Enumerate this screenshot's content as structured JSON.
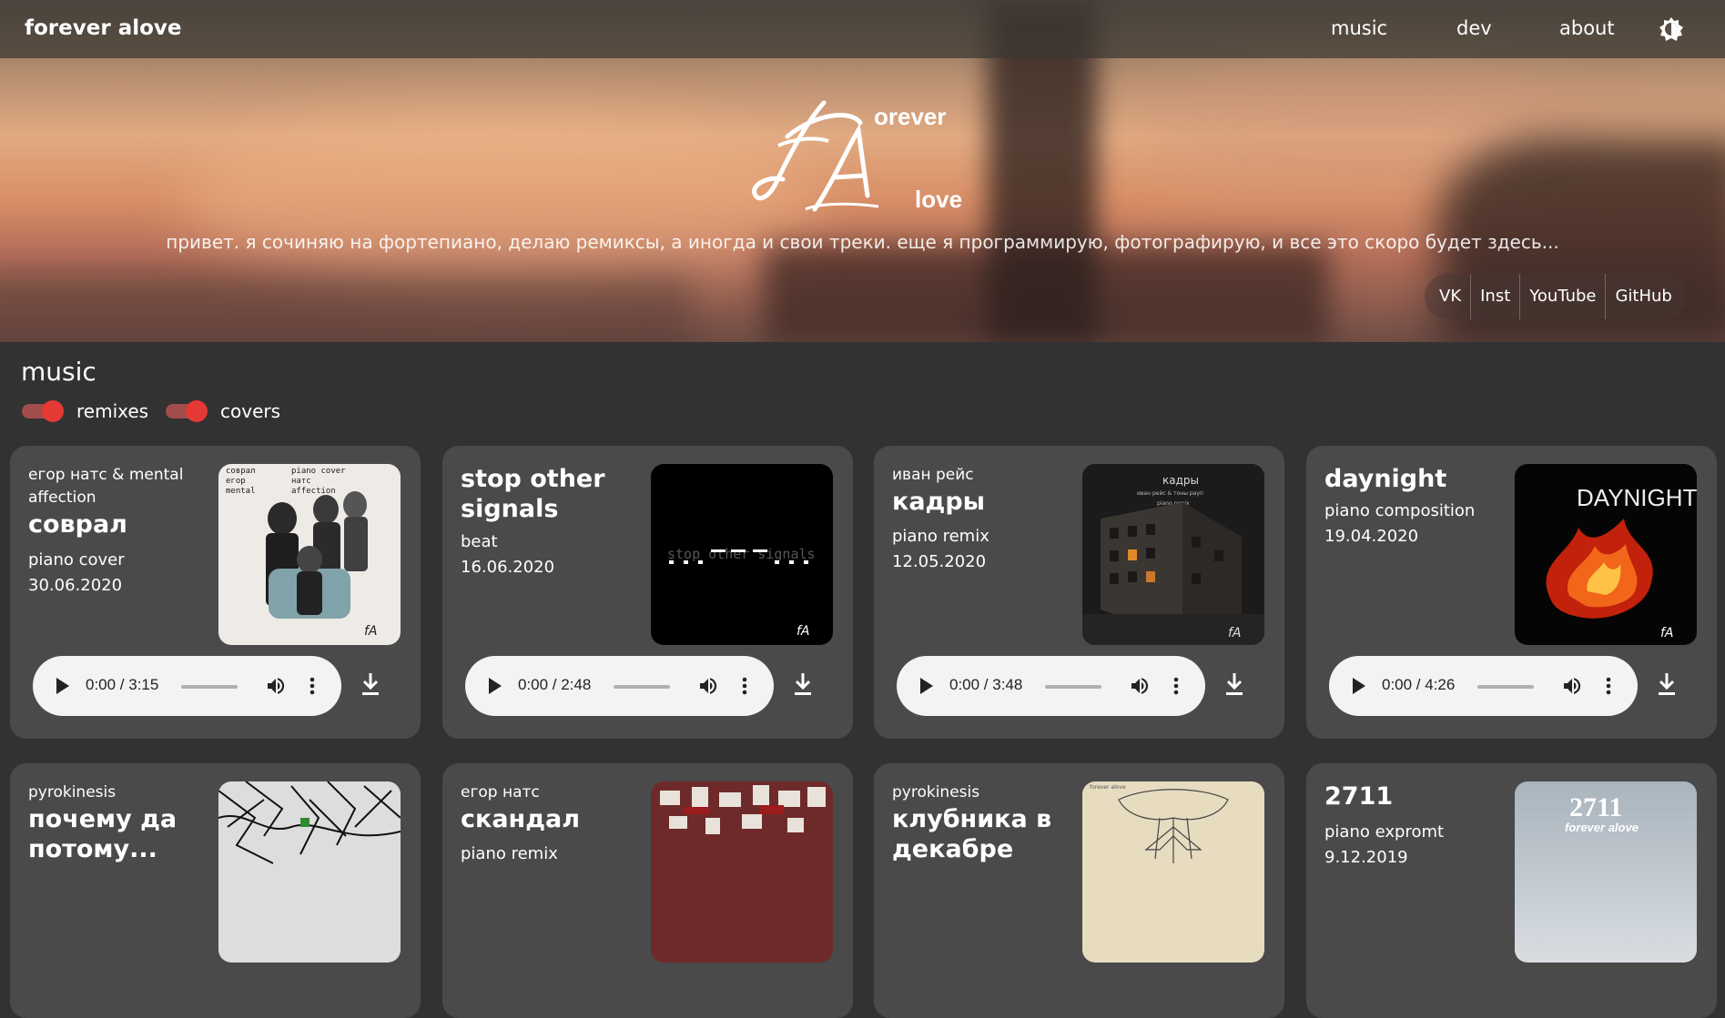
{
  "nav": {
    "brand": "forever alove",
    "links": [
      "music",
      "dev",
      "about"
    ],
    "theme_icon": "theme-toggle-icon"
  },
  "hero": {
    "logo_text_top": "orever",
    "logo_text_bottom": "love",
    "tagline": "привет. я сочиняю на фортепиано, делаю ремиксы, а иногда и свои треки. еще я программирую, фотографирую, и все это скоро будет здесь...",
    "social": [
      "VK",
      "Inst",
      "YouTube",
      "GitHub"
    ]
  },
  "music": {
    "title": "music",
    "filters": [
      {
        "label": "remixes",
        "on": true
      },
      {
        "label": "covers",
        "on": true
      }
    ],
    "tracks": [
      {
        "artist": "егор натс & mental affection",
        "title": "соврал",
        "kind": "piano cover",
        "date": "30.06.2020",
        "time": "0:00 / 3:15"
      },
      {
        "artist": "",
        "title": "stop other signals",
        "kind": "beat",
        "date": "16.06.2020",
        "time": "0:00 / 2:48"
      },
      {
        "artist": "иван рейс",
        "title": "кадры",
        "kind": "piano remix",
        "date": "12.05.2020",
        "time": "0:00 / 3:48"
      },
      {
        "artist": "",
        "title": "daynight",
        "kind": "piano composition",
        "date": "19.04.2020",
        "time": "0:00 / 4:26"
      },
      {
        "artist": "pyrokinesis",
        "title": "почему да потому...",
        "kind": "",
        "date": ""
      },
      {
        "artist": "егор натс",
        "title": "скандал",
        "kind": "piano remix",
        "date": ""
      },
      {
        "artist": "pyrokinesis",
        "title": "клубника в декабре",
        "kind": "",
        "date": ""
      },
      {
        "artist": "",
        "title": "2711",
        "kind": "piano expromt",
        "date": "9.12.2019"
      }
    ],
    "cover_texts": {
      "sovral": [
        "соврал",
        "егор",
        "mental",
        "piano cover",
        "натс",
        "affection"
      ],
      "stop": "stop other signals",
      "kadry": [
        "кадры",
        "иван рейс & тоны рауп",
        "piano remix"
      ],
      "daynight": "DAYNIGHT",
      "t2711": [
        "2711",
        "forever alove"
      ],
      "klubnika": "forever alove"
    }
  }
}
